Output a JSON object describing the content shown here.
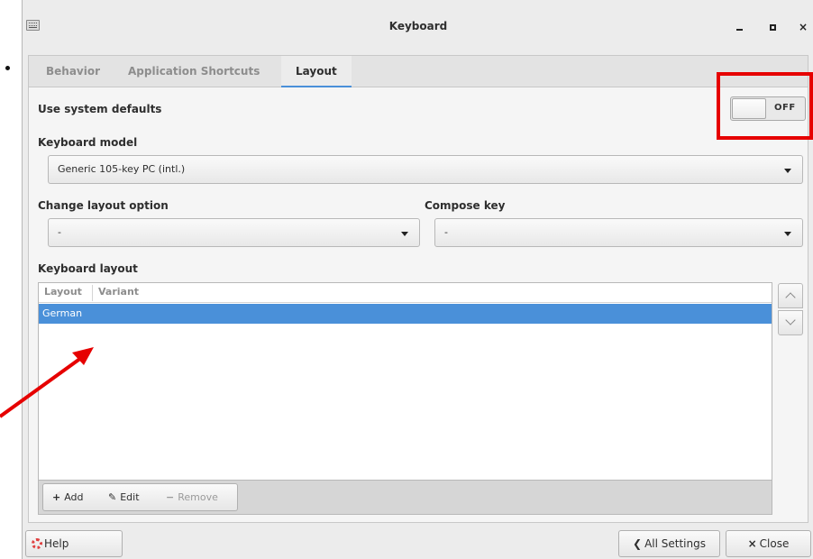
{
  "window": {
    "title": "Keyboard",
    "icon": "keyboard-icon",
    "controls": {
      "minimize": "minimize-icon",
      "maximize": "maximize-icon",
      "close": "×"
    }
  },
  "tabs": [
    {
      "label": "Behavior",
      "active": false
    },
    {
      "label": "Application Shortcuts",
      "active": false
    },
    {
      "label": "Layout",
      "active": true
    }
  ],
  "layout_tab": {
    "use_system_defaults": {
      "label": "Use system defaults",
      "switch_state": "OFF"
    },
    "keyboard_model": {
      "label": "Keyboard model",
      "value": "Generic 105-key PC (intl.)"
    },
    "change_layout_option": {
      "label": "Change layout option",
      "value": "-"
    },
    "compose_key": {
      "label": "Compose key",
      "value": "-"
    },
    "keyboard_layout": {
      "label": "Keyboard layout",
      "columns": [
        "Layout",
        "Variant"
      ],
      "rows": [
        {
          "layout": "German",
          "variant": "",
          "selected": true
        }
      ],
      "buttons": {
        "add": "Add",
        "edit": "Edit",
        "remove": "Remove"
      },
      "glyphs": {
        "add": "+",
        "edit": "✎",
        "remove": "−"
      }
    }
  },
  "footer": {
    "help": "Help",
    "all_settings": "All Settings",
    "all_settings_glyph": "❮",
    "close": "Close",
    "close_glyph": "×"
  },
  "colors": {
    "accent": "#4a90d9",
    "annotation": "#e60000"
  }
}
